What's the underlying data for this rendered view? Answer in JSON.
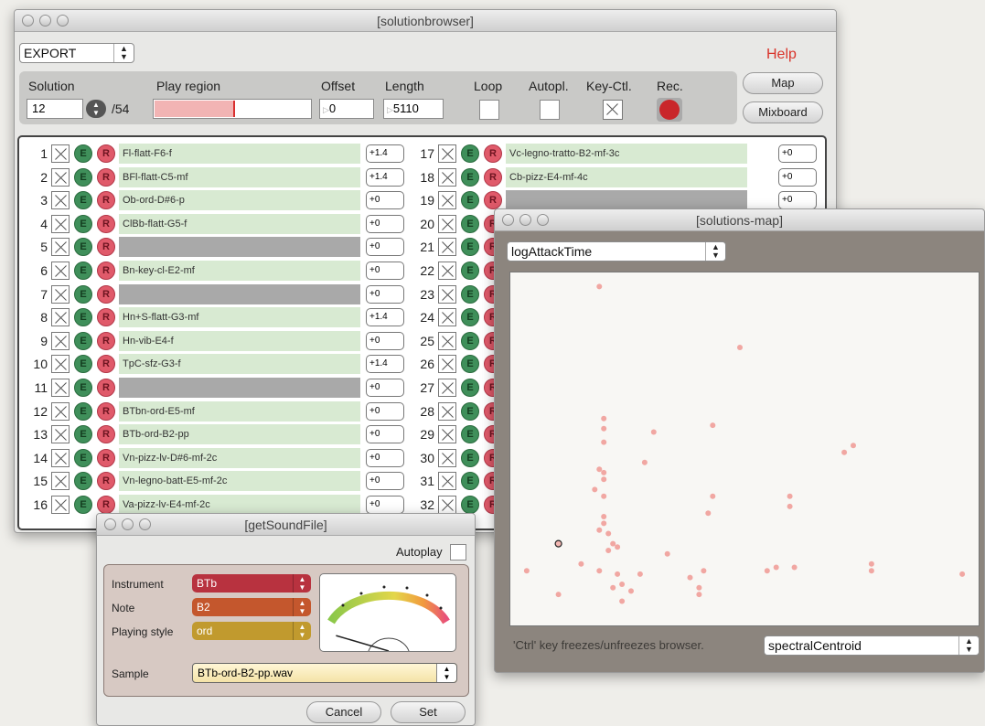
{
  "main_window": {
    "title": "[solutionbrowser]",
    "mode_select": "EXPORT",
    "help_label": "Help",
    "labels": {
      "solution": "Solution",
      "play_region": "Play region",
      "offset": "Offset",
      "length": "Length",
      "loop": "Loop",
      "autoplay": "Autopl.",
      "key_ctl": "Key-Ctl.",
      "rec": "Rec."
    },
    "solution_value": "12",
    "solution_total": "/54",
    "play_region_fraction": 0.52,
    "offset_value": "0",
    "length_value": "5110",
    "map_button": "Map",
    "mixboard_button": "Mixboard",
    "rows_left": [
      {
        "num": "1",
        "name": "Fl-flatt-F6-f",
        "offset": "+1.4"
      },
      {
        "num": "2",
        "name": "BFl-flatt-C5-mf",
        "offset": "+1.4"
      },
      {
        "num": "3",
        "name": "Ob-ord-D#6-p",
        "offset": "+0"
      },
      {
        "num": "4",
        "name": "ClBb-flatt-G5-f",
        "offset": "+0"
      },
      {
        "num": "5",
        "name": "",
        "offset": "+0"
      },
      {
        "num": "6",
        "name": "Bn-key-cl-E2-mf",
        "offset": "+0"
      },
      {
        "num": "7",
        "name": "",
        "offset": "+0"
      },
      {
        "num": "8",
        "name": "Hn+S-flatt-G3-mf",
        "offset": "+1.4"
      },
      {
        "num": "9",
        "name": "Hn-vib-E4-f",
        "offset": "+0"
      },
      {
        "num": "10",
        "name": "TpC-sfz-G3-f",
        "offset": "+1.4"
      },
      {
        "num": "11",
        "name": "",
        "offset": "+0"
      },
      {
        "num": "12",
        "name": "BTbn-ord-E5-mf",
        "offset": "+0"
      },
      {
        "num": "13",
        "name": "BTb-ord-B2-pp",
        "offset": "+0"
      },
      {
        "num": "14",
        "name": "Vn-pizz-lv-D#6-mf-2c",
        "offset": "+0"
      },
      {
        "num": "15",
        "name": "Vn-legno-batt-E5-mf-2c",
        "offset": "+0"
      },
      {
        "num": "16",
        "name": "Va-pizz-lv-E4-mf-2c",
        "offset": "+0"
      }
    ],
    "rows_right": [
      {
        "num": "17",
        "name": "Vc-legno-tratto-B2-mf-3c",
        "offset": "+0"
      },
      {
        "num": "18",
        "name": "Cb-pizz-E4-mf-4c",
        "offset": "+0"
      },
      {
        "num": "19",
        "name": "",
        "offset": "+0"
      },
      {
        "num": "20",
        "name": "",
        "offset": ""
      },
      {
        "num": "21",
        "name": "",
        "offset": ""
      },
      {
        "num": "22",
        "name": "",
        "offset": ""
      },
      {
        "num": "23",
        "name": "",
        "offset": ""
      },
      {
        "num": "24",
        "name": "",
        "offset": ""
      },
      {
        "num": "25",
        "name": "",
        "offset": ""
      },
      {
        "num": "26",
        "name": "",
        "offset": ""
      },
      {
        "num": "27",
        "name": "",
        "offset": ""
      },
      {
        "num": "28",
        "name": "",
        "offset": ""
      },
      {
        "num": "29",
        "name": "",
        "offset": ""
      },
      {
        "num": "30",
        "name": "",
        "offset": ""
      },
      {
        "num": "31",
        "name": "",
        "offset": ""
      },
      {
        "num": "32",
        "name": "",
        "offset": ""
      }
    ],
    "e_label": "E",
    "r_label": "R"
  },
  "map_window": {
    "title": "[solutions-map]",
    "y_feature": "logAttackTime",
    "x_feature": "spectralCentroid",
    "hint": "'Ctrl' key freezes/unfreezes browser.",
    "chart_data": {
      "type": "scatter",
      "title": "",
      "xlabel": "spectralCentroid",
      "ylabel": "logAttackTime",
      "xlim": [
        0,
        100
      ],
      "ylim": [
        0,
        100
      ],
      "grid": false,
      "points": [
        [
          18,
          98
        ],
        [
          49,
          80
        ],
        [
          19,
          59
        ],
        [
          19,
          56
        ],
        [
          30,
          55
        ],
        [
          43,
          57
        ],
        [
          19,
          52
        ],
        [
          28,
          46
        ],
        [
          72,
          49
        ],
        [
          74,
          51
        ],
        [
          18,
          44
        ],
        [
          19,
          43
        ],
        [
          19,
          41
        ],
        [
          17,
          38
        ],
        [
          19,
          36
        ],
        [
          43,
          36
        ],
        [
          42,
          31
        ],
        [
          60,
          36
        ],
        [
          60,
          33
        ],
        [
          19,
          30
        ],
        [
          19,
          28
        ],
        [
          18,
          26
        ],
        [
          20,
          25
        ],
        [
          21,
          22
        ],
        [
          22,
          21
        ],
        [
          20,
          20
        ],
        [
          33,
          19
        ],
        [
          14,
          16
        ],
        [
          18,
          14
        ],
        [
          2,
          14
        ],
        [
          22,
          13
        ],
        [
          27,
          13
        ],
        [
          38,
          12
        ],
        [
          41,
          14
        ],
        [
          55,
          14
        ],
        [
          57,
          15
        ],
        [
          61,
          15
        ],
        [
          78,
          16
        ],
        [
          78,
          14
        ],
        [
          98,
          13
        ],
        [
          21,
          9
        ],
        [
          23,
          10
        ],
        [
          25,
          8
        ],
        [
          40,
          9
        ],
        [
          40,
          7
        ],
        [
          9,
          7
        ],
        [
          23,
          5
        ]
      ],
      "selected_point": [
        9,
        22
      ]
    }
  },
  "sound_file_window": {
    "title": "[getSoundFile]",
    "autoplay_label": "Autoplay",
    "instrument_label": "Instrument",
    "instrument_value": "BTb",
    "note_label": "Note",
    "note_value": "B2",
    "playing_style_label": "Playing style",
    "playing_style_value": "ord",
    "sample_label": "Sample",
    "sample_value": "BTb-ord-B2-pp.wav",
    "cancel_button": "Cancel",
    "set_button": "Set",
    "colors": {
      "instrument": "#b8323f",
      "note": "#c4572d",
      "playing_style": "#c19a2e"
    },
    "dynamic_level": 0.12
  },
  "colors": {
    "on_row": "#d8ead2",
    "off_row": "#a9a9a9",
    "map_point": "#f1a7a2",
    "help": "#d9342b"
  }
}
